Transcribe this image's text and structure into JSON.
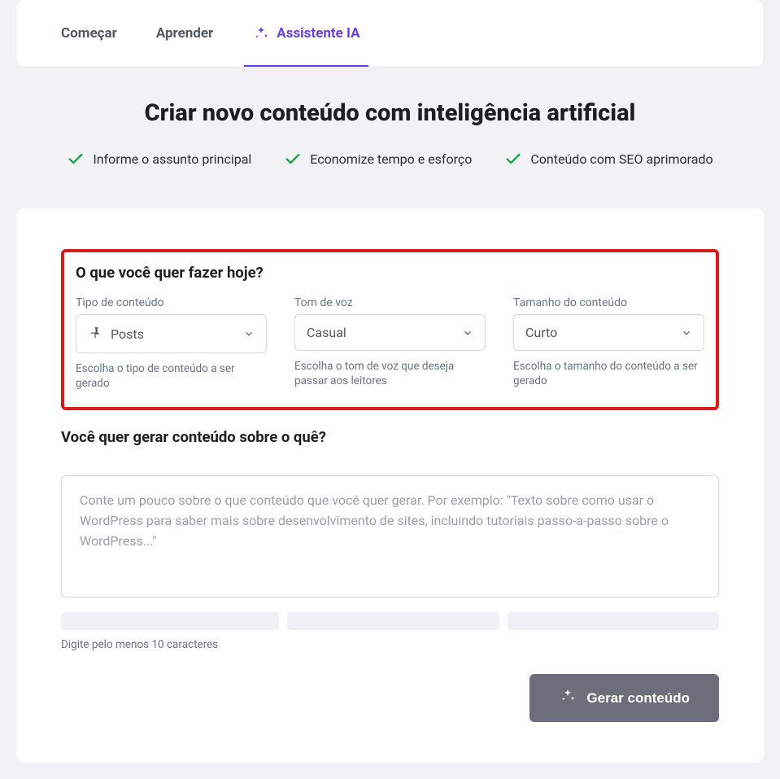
{
  "tabs": {
    "start": "Começar",
    "learn": "Aprender",
    "ai": "Assistente IA"
  },
  "hero": {
    "title": "Criar novo conteúdo com inteligência artificial",
    "benefits": {
      "b1": "Informe o assunto principal",
      "b2": "Economize tempo e esforço",
      "b3": "Conteúdo com SEO aprimorado"
    }
  },
  "form": {
    "section1_title": "O que você quer fazer hoje?",
    "content_type": {
      "label": "Tipo de conteúdo",
      "value": "Posts",
      "help": "Escolha o tipo de conteúdo a ser gerado"
    },
    "tone": {
      "label": "Tom de voz",
      "value": "Casual",
      "help": "Escolha o tom de voz que deseja passar aos leitores"
    },
    "length": {
      "label": "Tamanho do conteúdo",
      "value": "Curto",
      "help": "Escolha o tamanho do conteúdo a ser gerado"
    },
    "section2_title": "Você quer gerar conteúdo sobre o quê?",
    "textarea_placeholder": "Conte um pouco sobre o que conteúdo que você quer gerar. Por exemplo: \"Texto sobre como usar o WordPress para saber mais sobre desenvolvimento de sites, incluindo tutoriais passo-a-passo sobre o WordPress...\"",
    "min_chars_hint": "Digite pelo menos 10 caracteres",
    "generate_label": "Gerar conteúdo"
  }
}
